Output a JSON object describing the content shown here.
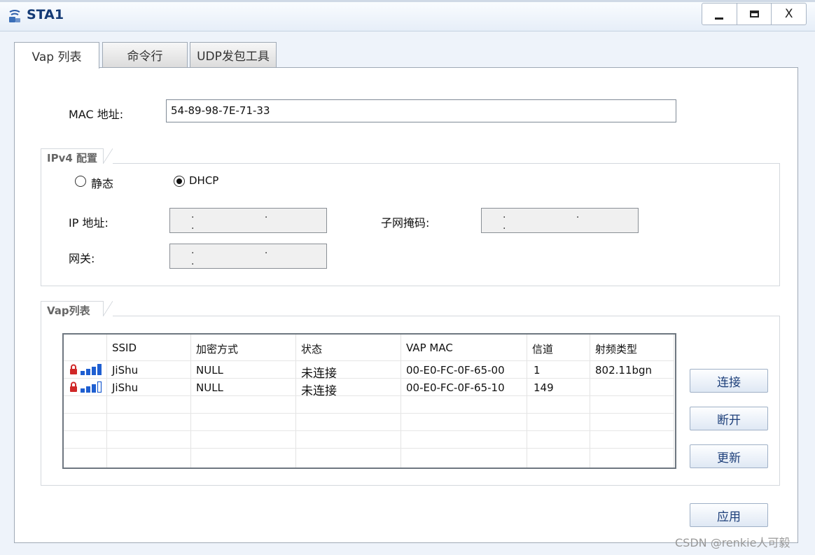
{
  "window": {
    "title": "STA1",
    "close_glyph": "X",
    "app_icon": "network-station-icon"
  },
  "tabs": [
    {
      "label": "Vap 列表"
    },
    {
      "label": "命令行"
    },
    {
      "label": "UDP发包工具"
    }
  ],
  "mac": {
    "label": "MAC 地址:",
    "value": "54-89-98-7E-71-33"
  },
  "ipv4": {
    "group_title": "IPv4 配置",
    "static_label": "静态",
    "dhcp_label": "DHCP",
    "selected": "DHCP",
    "ip_label": "IP 地址:",
    "mask_label": "子网掩码:",
    "gateway_label": "网关:",
    "ip_value": ". . .",
    "mask_value": ". . .",
    "gateway_value": ". . ."
  },
  "vap": {
    "group_title": "Vap列表",
    "columns": [
      "SSID",
      "加密方式",
      "状态",
      "VAP MAC",
      "信道",
      "射频类型"
    ],
    "rows": [
      {
        "ssid": "JiShu",
        "encryption": "NULL",
        "status": "未连接",
        "vap_mac": "00-E0-FC-0F-65-00",
        "channel": "1",
        "radio": "802.11bgn",
        "signal_bars": 4
      },
      {
        "ssid": "JiShu",
        "encryption": "NULL",
        "status": "未连接",
        "vap_mac": "00-E0-FC-0F-65-10",
        "channel": "149",
        "radio": "",
        "signal_bars": 3
      }
    ]
  },
  "buttons": {
    "connect": "连接",
    "disconnect": "断开",
    "refresh": "更新",
    "apply": "应用"
  },
  "watermark": "CSDN @renkie人可毅",
  "colors": {
    "title": "#143a75",
    "button_text": "#1d3f7a",
    "signal": "#1f5fd1",
    "lock": "#d02828"
  }
}
